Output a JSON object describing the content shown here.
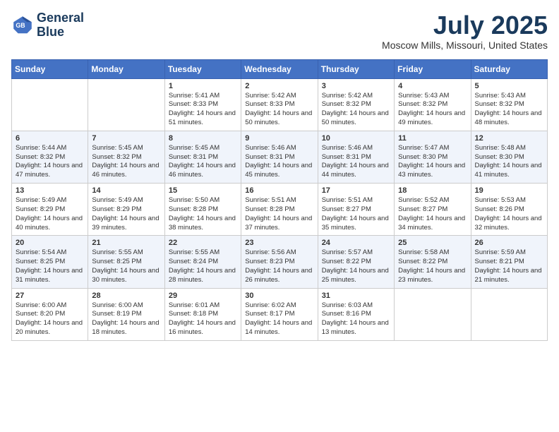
{
  "logo": {
    "line1": "General",
    "line2": "Blue"
  },
  "title": {
    "month_year": "July 2025",
    "location": "Moscow Mills, Missouri, United States"
  },
  "weekdays": [
    "Sunday",
    "Monday",
    "Tuesday",
    "Wednesday",
    "Thursday",
    "Friday",
    "Saturday"
  ],
  "weeks": [
    [
      {
        "day": "",
        "sunrise": "",
        "sunset": "",
        "daylight": ""
      },
      {
        "day": "",
        "sunrise": "",
        "sunset": "",
        "daylight": ""
      },
      {
        "day": "1",
        "sunrise": "Sunrise: 5:41 AM",
        "sunset": "Sunset: 8:33 PM",
        "daylight": "Daylight: 14 hours and 51 minutes."
      },
      {
        "day": "2",
        "sunrise": "Sunrise: 5:42 AM",
        "sunset": "Sunset: 8:33 PM",
        "daylight": "Daylight: 14 hours and 50 minutes."
      },
      {
        "day": "3",
        "sunrise": "Sunrise: 5:42 AM",
        "sunset": "Sunset: 8:32 PM",
        "daylight": "Daylight: 14 hours and 50 minutes."
      },
      {
        "day": "4",
        "sunrise": "Sunrise: 5:43 AM",
        "sunset": "Sunset: 8:32 PM",
        "daylight": "Daylight: 14 hours and 49 minutes."
      },
      {
        "day": "5",
        "sunrise": "Sunrise: 5:43 AM",
        "sunset": "Sunset: 8:32 PM",
        "daylight": "Daylight: 14 hours and 48 minutes."
      }
    ],
    [
      {
        "day": "6",
        "sunrise": "Sunrise: 5:44 AM",
        "sunset": "Sunset: 8:32 PM",
        "daylight": "Daylight: 14 hours and 47 minutes."
      },
      {
        "day": "7",
        "sunrise": "Sunrise: 5:45 AM",
        "sunset": "Sunset: 8:32 PM",
        "daylight": "Daylight: 14 hours and 46 minutes."
      },
      {
        "day": "8",
        "sunrise": "Sunrise: 5:45 AM",
        "sunset": "Sunset: 8:31 PM",
        "daylight": "Daylight: 14 hours and 46 minutes."
      },
      {
        "day": "9",
        "sunrise": "Sunrise: 5:46 AM",
        "sunset": "Sunset: 8:31 PM",
        "daylight": "Daylight: 14 hours and 45 minutes."
      },
      {
        "day": "10",
        "sunrise": "Sunrise: 5:46 AM",
        "sunset": "Sunset: 8:31 PM",
        "daylight": "Daylight: 14 hours and 44 minutes."
      },
      {
        "day": "11",
        "sunrise": "Sunrise: 5:47 AM",
        "sunset": "Sunset: 8:30 PM",
        "daylight": "Daylight: 14 hours and 43 minutes."
      },
      {
        "day": "12",
        "sunrise": "Sunrise: 5:48 AM",
        "sunset": "Sunset: 8:30 PM",
        "daylight": "Daylight: 14 hours and 41 minutes."
      }
    ],
    [
      {
        "day": "13",
        "sunrise": "Sunrise: 5:49 AM",
        "sunset": "Sunset: 8:29 PM",
        "daylight": "Daylight: 14 hours and 40 minutes."
      },
      {
        "day": "14",
        "sunrise": "Sunrise: 5:49 AM",
        "sunset": "Sunset: 8:29 PM",
        "daylight": "Daylight: 14 hours and 39 minutes."
      },
      {
        "day": "15",
        "sunrise": "Sunrise: 5:50 AM",
        "sunset": "Sunset: 8:28 PM",
        "daylight": "Daylight: 14 hours and 38 minutes."
      },
      {
        "day": "16",
        "sunrise": "Sunrise: 5:51 AM",
        "sunset": "Sunset: 8:28 PM",
        "daylight": "Daylight: 14 hours and 37 minutes."
      },
      {
        "day": "17",
        "sunrise": "Sunrise: 5:51 AM",
        "sunset": "Sunset: 8:27 PM",
        "daylight": "Daylight: 14 hours and 35 minutes."
      },
      {
        "day": "18",
        "sunrise": "Sunrise: 5:52 AM",
        "sunset": "Sunset: 8:27 PM",
        "daylight": "Daylight: 14 hours and 34 minutes."
      },
      {
        "day": "19",
        "sunrise": "Sunrise: 5:53 AM",
        "sunset": "Sunset: 8:26 PM",
        "daylight": "Daylight: 14 hours and 32 minutes."
      }
    ],
    [
      {
        "day": "20",
        "sunrise": "Sunrise: 5:54 AM",
        "sunset": "Sunset: 8:25 PM",
        "daylight": "Daylight: 14 hours and 31 minutes."
      },
      {
        "day": "21",
        "sunrise": "Sunrise: 5:55 AM",
        "sunset": "Sunset: 8:25 PM",
        "daylight": "Daylight: 14 hours and 30 minutes."
      },
      {
        "day": "22",
        "sunrise": "Sunrise: 5:55 AM",
        "sunset": "Sunset: 8:24 PM",
        "daylight": "Daylight: 14 hours and 28 minutes."
      },
      {
        "day": "23",
        "sunrise": "Sunrise: 5:56 AM",
        "sunset": "Sunset: 8:23 PM",
        "daylight": "Daylight: 14 hours and 26 minutes."
      },
      {
        "day": "24",
        "sunrise": "Sunrise: 5:57 AM",
        "sunset": "Sunset: 8:22 PM",
        "daylight": "Daylight: 14 hours and 25 minutes."
      },
      {
        "day": "25",
        "sunrise": "Sunrise: 5:58 AM",
        "sunset": "Sunset: 8:22 PM",
        "daylight": "Daylight: 14 hours and 23 minutes."
      },
      {
        "day": "26",
        "sunrise": "Sunrise: 5:59 AM",
        "sunset": "Sunset: 8:21 PM",
        "daylight": "Daylight: 14 hours and 21 minutes."
      }
    ],
    [
      {
        "day": "27",
        "sunrise": "Sunrise: 6:00 AM",
        "sunset": "Sunset: 8:20 PM",
        "daylight": "Daylight: 14 hours and 20 minutes."
      },
      {
        "day": "28",
        "sunrise": "Sunrise: 6:00 AM",
        "sunset": "Sunset: 8:19 PM",
        "daylight": "Daylight: 14 hours and 18 minutes."
      },
      {
        "day": "29",
        "sunrise": "Sunrise: 6:01 AM",
        "sunset": "Sunset: 8:18 PM",
        "daylight": "Daylight: 14 hours and 16 minutes."
      },
      {
        "day": "30",
        "sunrise": "Sunrise: 6:02 AM",
        "sunset": "Sunset: 8:17 PM",
        "daylight": "Daylight: 14 hours and 14 minutes."
      },
      {
        "day": "31",
        "sunrise": "Sunrise: 6:03 AM",
        "sunset": "Sunset: 8:16 PM",
        "daylight": "Daylight: 14 hours and 13 minutes."
      },
      {
        "day": "",
        "sunrise": "",
        "sunset": "",
        "daylight": ""
      },
      {
        "day": "",
        "sunrise": "",
        "sunset": "",
        "daylight": ""
      }
    ]
  ]
}
